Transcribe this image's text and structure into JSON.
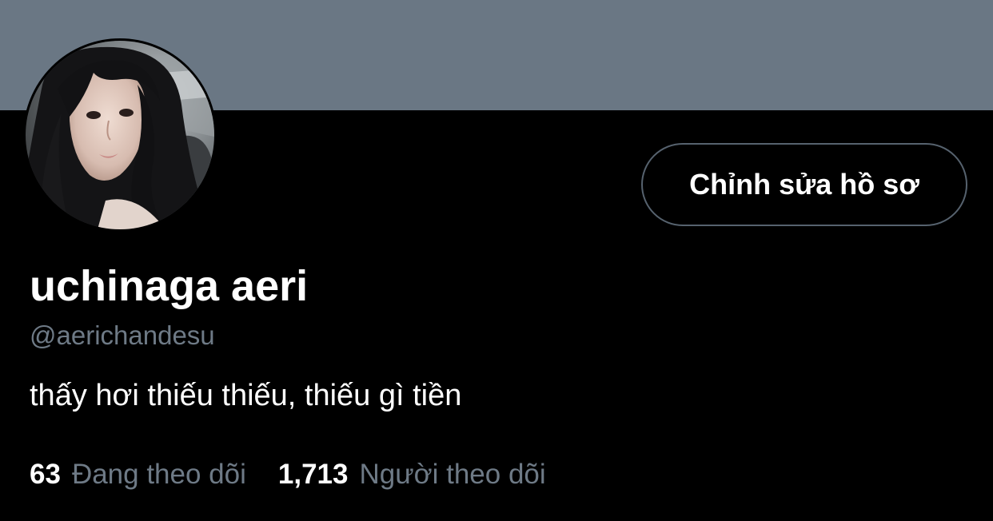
{
  "profile": {
    "display_name": "uchinaga aeri",
    "handle": "@aerichandesu",
    "bio": "thấy hơi thiếu thiếu, thiếu gì tiền",
    "avatar_icon": "profile-photo",
    "banner_color": "#6a7784"
  },
  "actions": {
    "edit_profile_label": "Chỉnh sửa hồ sơ"
  },
  "stats": {
    "following": {
      "count": "63",
      "label": "Đang theo dõi"
    },
    "followers": {
      "count": "1,713",
      "label": "Người theo dõi"
    }
  },
  "colors": {
    "background": "#000000",
    "secondary_text": "#6e7a86",
    "button_border": "#56626e"
  }
}
